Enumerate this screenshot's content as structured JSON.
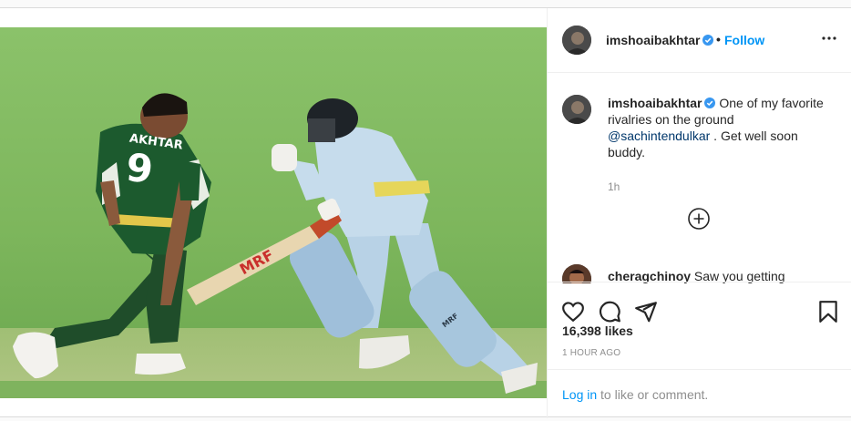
{
  "post": {
    "image_alt": "Cricket photo: bowler in green Pakistan kit and batsman in light blue India kit running",
    "jersey": {
      "name": "AKHTAR",
      "number": "9"
    },
    "bat_brand": "MRF",
    "pad_brand": "MRF"
  },
  "header": {
    "username": "imshoaibakhtar",
    "verified_icon": "verified-badge-icon",
    "separator": "•",
    "follow_label": "Follow",
    "more_icon": "more-options-icon"
  },
  "caption": {
    "username": "imshoaibakhtar",
    "text_before": " One of my favorite rivalries on the ground ",
    "mention": "@sachintendulkar",
    "text_after": " . Get well soon buddy.",
    "time": "1h"
  },
  "load_more_icon": "plus-circle-icon",
  "comment": {
    "username": "cheragchinoy",
    "text": " Saw you getting"
  },
  "actions": {
    "like_icon": "heart-icon",
    "comment_icon": "comment-icon",
    "share_icon": "share-icon",
    "save_icon": "bookmark-icon"
  },
  "likes": "16,398 likes",
  "posted_ago": "1 HOUR AGO",
  "login": {
    "link": "Log in",
    "rest": " to like or comment."
  },
  "colors": {
    "accent": "#0095f6",
    "mention": "#00376b",
    "muted": "#8e8e8e",
    "text": "#262626"
  }
}
